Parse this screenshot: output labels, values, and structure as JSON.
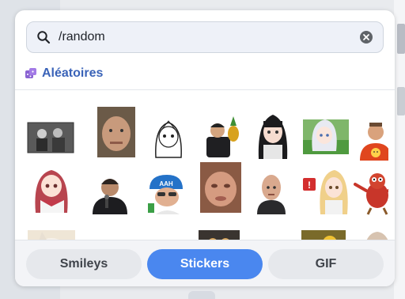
{
  "search": {
    "value": "/random",
    "placeholder": ""
  },
  "category": {
    "label": "Aléatoires",
    "icon": "dice-icon",
    "color": "#3a63b8"
  },
  "tabs": [
    {
      "label": "Smileys",
      "active": false
    },
    {
      "label": "Stickers",
      "active": true
    },
    {
      "label": "GIF",
      "active": false
    }
  ],
  "colors": {
    "accent": "#4a87ef",
    "category": "#3a63b8"
  },
  "stickers": [
    {
      "name": "sticker-black-white-photo"
    },
    {
      "name": "sticker-man-selfie-face"
    },
    {
      "name": "sticker-anime-sketch-girl"
    },
    {
      "name": "sticker-man-holding-pineapple"
    },
    {
      "name": "sticker-anime-girl-black-hair"
    },
    {
      "name": "sticker-anime-girl-white-hair"
    },
    {
      "name": "sticker-man-orange-shirt-emoji"
    },
    {
      "name": "sticker-anime-girl-pink-hair"
    },
    {
      "name": "sticker-man-speaking-microphone"
    },
    {
      "name": "sticker-aah-blue-cap-man"
    },
    {
      "name": "sticker-blurry-face-closeup"
    },
    {
      "name": "sticker-bald-man-face"
    },
    {
      "name": "sticker-anime-girl-red-sign"
    },
    {
      "name": "sticker-red-muppet"
    },
    {
      "name": "sticker-cat-row3"
    },
    {
      "name": "sticker-face-row3"
    },
    {
      "name": "sticker-dog-row3"
    },
    {
      "name": "sticker-owl-row3"
    },
    {
      "name": "sticker-super-text"
    },
    {
      "name": "sticker-sunflowers"
    },
    {
      "name": "sticker-anime-row3"
    }
  ]
}
